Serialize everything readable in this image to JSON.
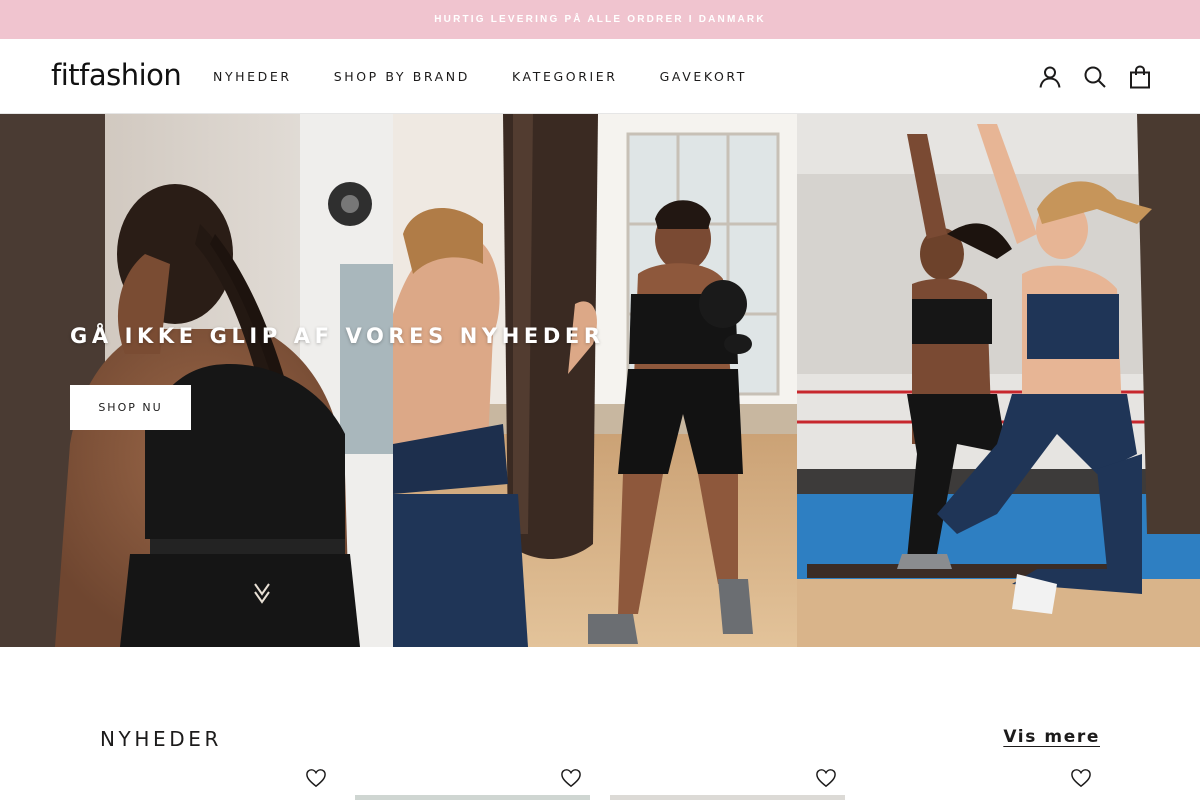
{
  "announcement": {
    "text": "HURTIG LEVERING PÅ ALLE ORDRER I DANMARK"
  },
  "header": {
    "logo": "fitfashion",
    "nav": [
      "NYHEDER",
      "SHOP BY BRAND",
      "KATEGORIER",
      "GAVEKORT"
    ],
    "icons": [
      "account-icon",
      "search-icon",
      "cart-icon"
    ]
  },
  "hero": {
    "title": "GÅ IKKE GLIP AF VORES NYHEDER",
    "button": "SHOP NU"
  },
  "news": {
    "title": "NYHEDER",
    "more": "Vis mere",
    "product_icons": [
      "heart-icon",
      "heart-icon",
      "heart-icon",
      "heart-icon"
    ]
  },
  "colors": {
    "announcement_bg": "#f0c4cf",
    "text": "#1c1b1b",
    "navy": "#1f3557"
  }
}
